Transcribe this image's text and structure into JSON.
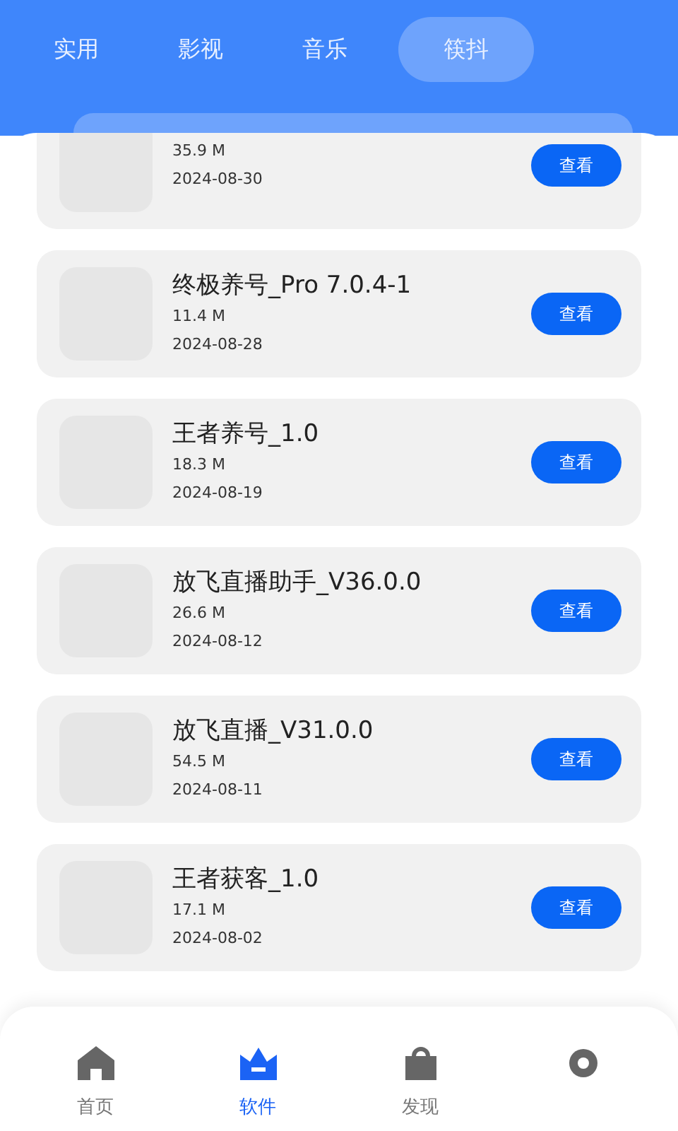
{
  "tabs": [
    {
      "label": "实用",
      "selected": false
    },
    {
      "label": "影视",
      "selected": false
    },
    {
      "label": "音乐",
      "selected": false
    },
    {
      "label": "筷抖",
      "selected": true
    }
  ],
  "apps": [
    {
      "clipped": true,
      "size": "35.9 M",
      "date": "2024-08-30",
      "action": "查看"
    },
    {
      "clipped": false,
      "title": "终极养号_Pro 7.0.4-1",
      "size": "11.4 M",
      "date": "2024-08-28",
      "action": "查看"
    },
    {
      "clipped": false,
      "title": "王者养号_1.0",
      "size": "18.3 M",
      "date": "2024-08-19",
      "action": "查看"
    },
    {
      "clipped": false,
      "title": "放飞直播助手_V36.0.0",
      "size": "26.6 M",
      "date": "2024-08-12",
      "action": "查看"
    },
    {
      "clipped": false,
      "title": "放飞直播_V31.0.0",
      "size": "54.5 M",
      "date": "2024-08-11",
      "action": "查看"
    },
    {
      "clipped": false,
      "title": "王者获客_1.0",
      "size": "17.1 M",
      "date": "2024-08-02",
      "action": "查看"
    }
  ],
  "bottom_nav": [
    {
      "kind": "home",
      "label": "首页",
      "selected": false
    },
    {
      "kind": "software",
      "label": "软件",
      "selected": true
    },
    {
      "kind": "discover",
      "label": "发现",
      "selected": false
    },
    {
      "kind": "settings",
      "selected": false
    }
  ]
}
